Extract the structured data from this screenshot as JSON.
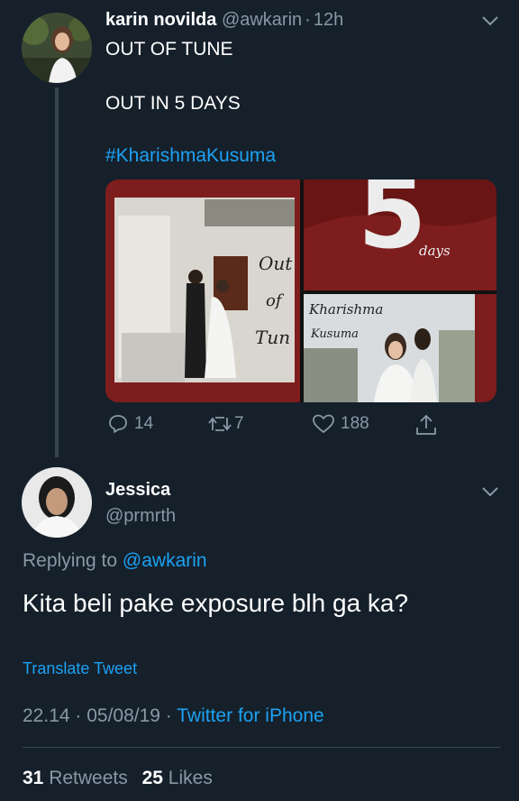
{
  "tweet": {
    "name": "karin novilda",
    "handle": "@awkarin",
    "sep": "·",
    "time": "12h",
    "line1": "OUT OF TUNE",
    "line2": "OUT IN 5 DAYS",
    "hashtag": "#KharishmaKusuma",
    "media": {
      "left_text_1": "Out",
      "left_text_2": "of",
      "left_text_3": "Tun",
      "big_number": "5",
      "days_label": "days",
      "br_text_1": "Kharishma",
      "br_text_2": "Kusuma"
    },
    "actions": {
      "reply_count": "14",
      "retweet_count": "7",
      "like_count": "188"
    }
  },
  "reply": {
    "name": "Jessica",
    "handle": "@prmrth",
    "replying_prefix": "Replying to",
    "replying_handle": "@awkarin",
    "text": "Kita beli pake exposure blh ga ka?",
    "translate": "Translate Tweet",
    "timestamp": "22.14 · 05/08/19 ·",
    "source": "Twitter for iPhone",
    "retweets_count": "31",
    "retweets_label": "Retweets",
    "likes_count": "25",
    "likes_label": "Likes"
  },
  "colors": {
    "background": "#15202b",
    "accent": "#1da1f2",
    "muted": "#8899a6",
    "media_red": "#7d1d1d"
  }
}
